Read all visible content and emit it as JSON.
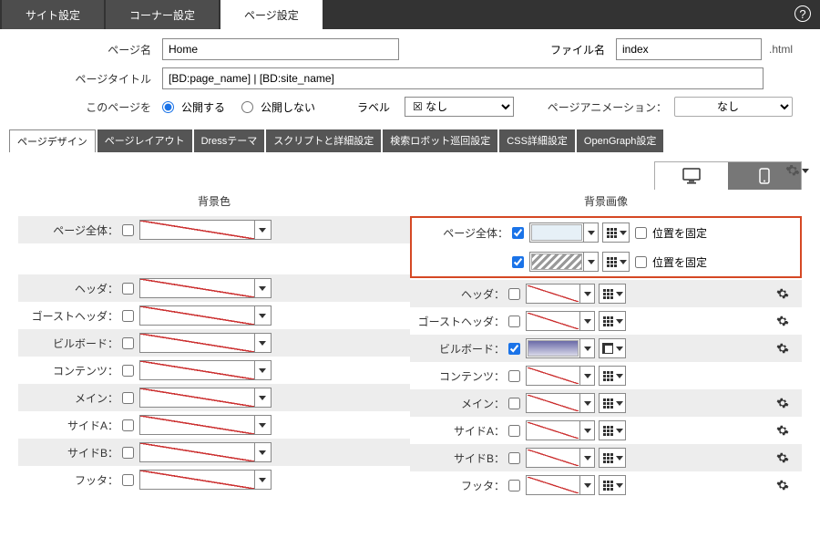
{
  "toptabs": {
    "site": "サイト設定",
    "corner": "コーナー設定",
    "page": "ページ設定"
  },
  "form": {
    "page_name_label": "ページ名",
    "page_name_value": "Home",
    "file_label": "ファイル名",
    "file_value": "index",
    "file_ext": ".html",
    "page_title_label": "ページタイトル",
    "page_title_value": "[BD:page_name] | [BD:site_name]",
    "publish_label": "このページを",
    "publish_on": "公開する",
    "publish_off": "公開しない",
    "label_label": "ラベル",
    "label_value": "☒ なし",
    "anim_label": "ページアニメーション：",
    "anim_value": "なし"
  },
  "subtabs": {
    "design": "ページデザイン",
    "layout": "ページレイアウト",
    "dress": "Dressテーマ",
    "script": "スクリプトと詳細設定",
    "robot": "検索ロボット巡回設定",
    "css": "CSS詳細設定",
    "og": "OpenGraph設定"
  },
  "section": {
    "bgcolor": "背景色",
    "bgimage": "背景画像"
  },
  "rows": {
    "whole": "ページ全体：",
    "header": "ヘッダ：",
    "ghost": "ゴーストヘッダ：",
    "billboard": "ビルボード：",
    "contents": "コンテンツ：",
    "main": "メイン：",
    "sidea": "サイドA：",
    "sideb": "サイドB：",
    "footer": "フッタ："
  },
  "misc": {
    "fixpos": "位置を固定"
  }
}
